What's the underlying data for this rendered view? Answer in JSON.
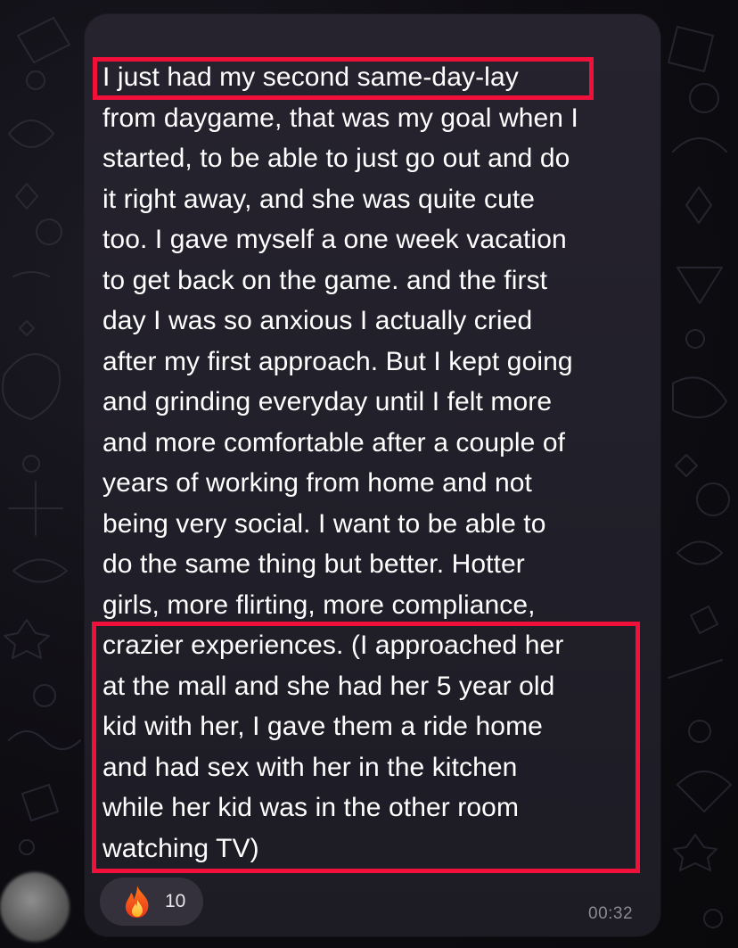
{
  "message": {
    "lines": [
      "I just had my second same-day-lay",
      "from daygame, that was my goal when I",
      "started, to be able to just go out and do",
      "it right away, and she was quite cute",
      "too. I gave myself a one week vacation",
      "to get back on the game. and the first",
      "day I was so anxious I actually cried",
      "after my first approach. But I kept going",
      "and grinding everyday until I felt more",
      "and more comfortable after a couple of",
      "years of working from home and not",
      "being very social. I want to be able to",
      "do the same thing but better. Hotter",
      "girls, more flirting, more compliance,",
      "crazier experiences. (I approached her",
      "at the mall and she had her 5 year old",
      "kid with her, I gave them a ride home",
      "and had sex with her in the kitchen",
      "while her kid was in the other room",
      "watching TV)"
    ],
    "timestamp": "00:32"
  },
  "reaction": {
    "emoji": "fire-icon",
    "count": "10"
  },
  "colors": {
    "highlight": "#f0103a",
    "bubble": "#221f2a",
    "text": "#ffffff",
    "timestamp": "#8b8894"
  }
}
